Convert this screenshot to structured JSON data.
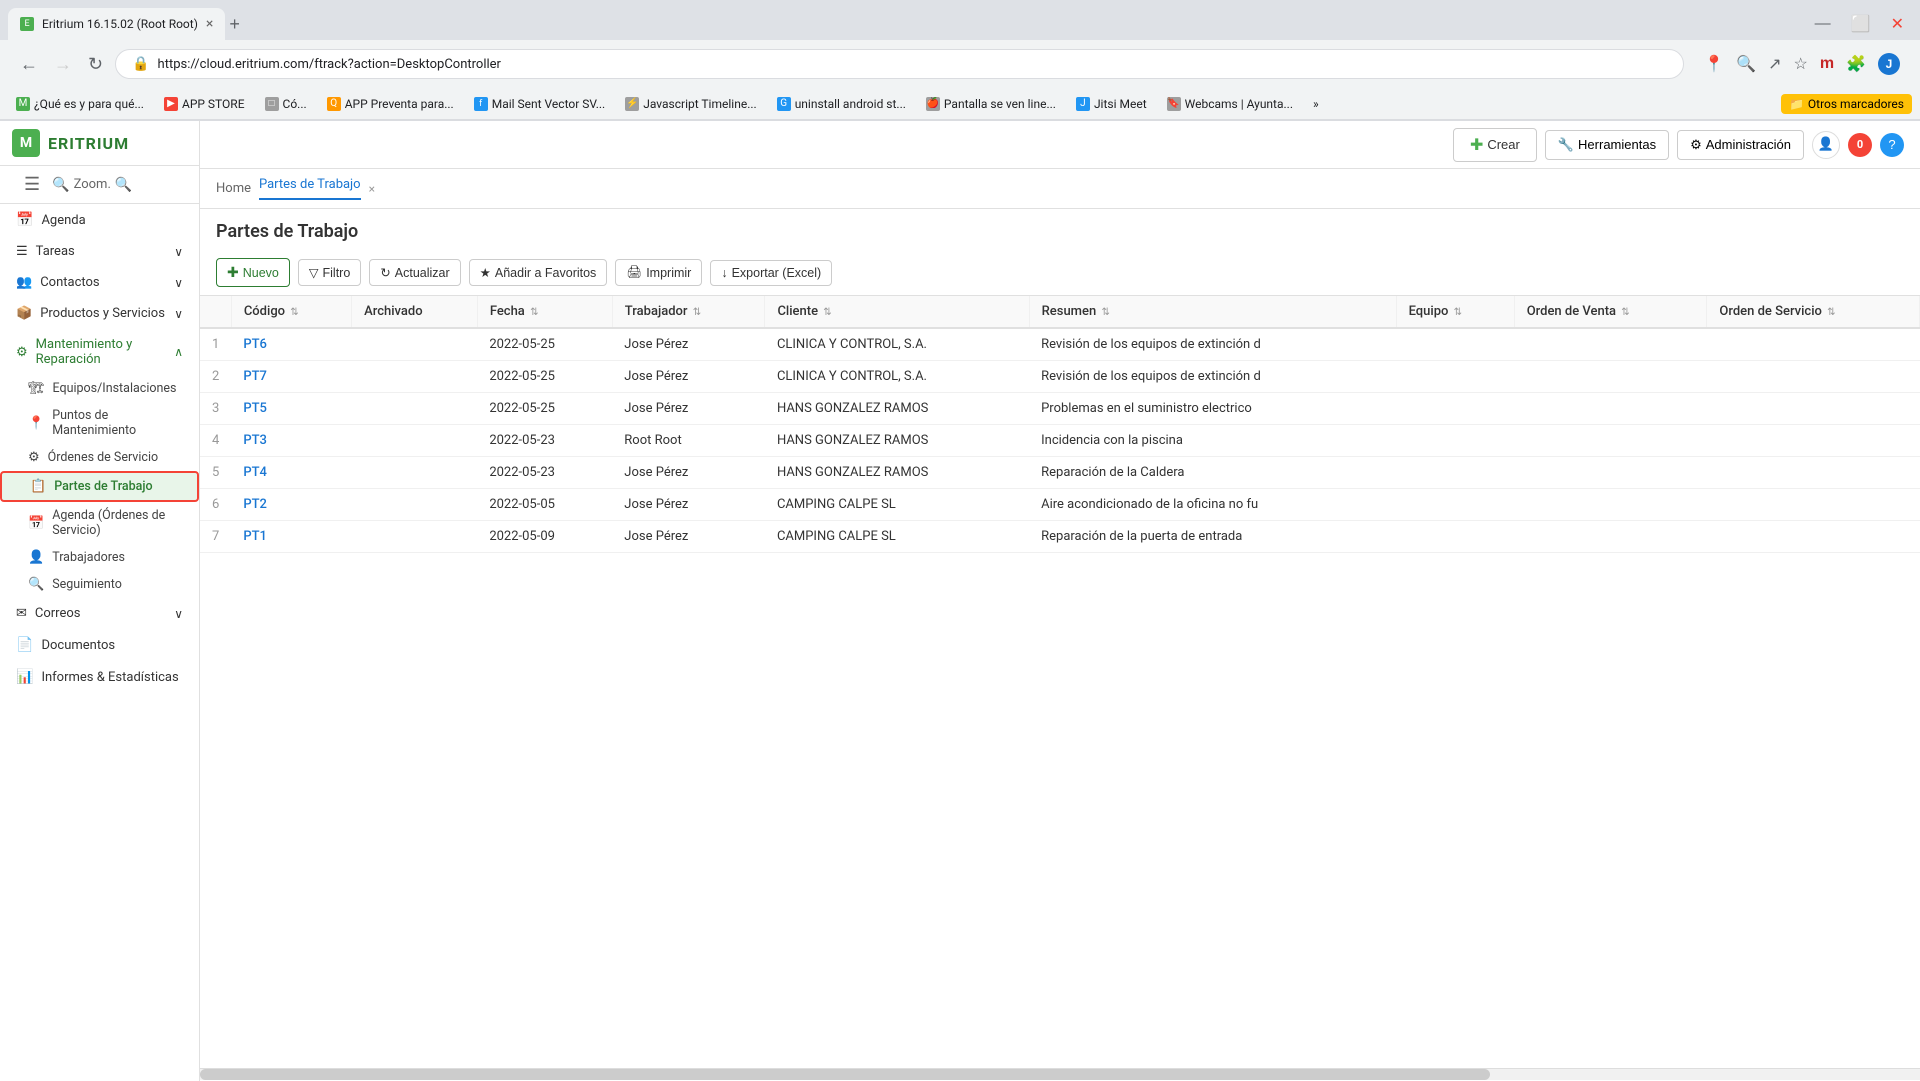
{
  "browser": {
    "tab_title": "Eritrium 16.15.02 (Root Root)",
    "url": "https://cloud.eritrium.com/ftrack?action=DesktopController",
    "bookmarks": [
      {
        "id": "bm1",
        "label": "¿Qué es y para qué...",
        "icon_color": "green",
        "icon_text": "M"
      },
      {
        "id": "bm2",
        "label": "APP STORE",
        "icon_color": "red",
        "icon_text": "▶"
      },
      {
        "id": "bm3",
        "label": "Có...",
        "icon_color": "gray",
        "icon_text": "□"
      },
      {
        "id": "bm4",
        "label": "APP Preventa para...",
        "icon_color": "orange",
        "icon_text": "Q"
      },
      {
        "id": "bm5",
        "label": "Mail Sent Vector SV...",
        "icon_color": "blue",
        "icon_text": "f"
      },
      {
        "id": "bm6",
        "label": "Javascript Timeline...",
        "icon_color": "gray",
        "icon_text": "⚡"
      },
      {
        "id": "bm7",
        "label": "uninstall android st...",
        "icon_color": "blue",
        "icon_text": "G"
      },
      {
        "id": "bm8",
        "label": "Pantalla se ven line...",
        "icon_color": "gray",
        "icon_text": "🍎"
      },
      {
        "id": "bm9",
        "label": "Jitsi Meet",
        "icon_color": "blue",
        "icon_text": "J"
      },
      {
        "id": "bm10",
        "label": "Webcams | Ayunta...",
        "icon_color": "gray",
        "icon_text": "🔖"
      },
      {
        "id": "bm11",
        "label": "»",
        "icon_color": "gray",
        "icon_text": ""
      },
      {
        "id": "bm12",
        "label": "Otros marcadores",
        "icon_color": "yellow",
        "icon_text": "📁"
      }
    ]
  },
  "app": {
    "logo_letter": "M",
    "logo_name": "ERITRIUM"
  },
  "topbar": {
    "zoom_label": "Zoom.",
    "crear_label": "Crear",
    "herramientas_label": "Herramientas",
    "admin_label": "Administración"
  },
  "sidebar": {
    "items": [
      {
        "id": "agenda",
        "label": "Agenda",
        "icon": "📅",
        "level": 0,
        "expandable": false
      },
      {
        "id": "tareas",
        "label": "Tareas",
        "icon": "☰",
        "level": 0,
        "expandable": true
      },
      {
        "id": "contactos",
        "label": "Contactos",
        "icon": "👥",
        "level": 0,
        "expandable": true
      },
      {
        "id": "productos",
        "label": "Productos y Servicios",
        "icon": "📦",
        "level": 0,
        "expandable": true
      },
      {
        "id": "mantenimiento",
        "label": "Mantenimiento y Reparación",
        "icon": "⚙",
        "level": 0,
        "expandable": true,
        "expanded": true
      },
      {
        "id": "equipos",
        "label": "Equipos/Instalaciones",
        "icon": "🏗",
        "level": 1
      },
      {
        "id": "puntos",
        "label": "Puntos de Mantenimiento",
        "icon": "📍",
        "level": 1
      },
      {
        "id": "ordenes",
        "label": "Órdenes de Servicio",
        "icon": "⚙",
        "level": 1
      },
      {
        "id": "partes",
        "label": "Partes de Trabajo",
        "icon": "📋",
        "level": 1,
        "active": true
      },
      {
        "id": "agenda_os",
        "label": "Agenda (Órdenes de Servicio)",
        "icon": "📅",
        "level": 1
      },
      {
        "id": "trabajadores",
        "label": "Trabajadores",
        "icon": "👤",
        "level": 1
      },
      {
        "id": "seguimiento",
        "label": "Seguimiento",
        "icon": "🔍",
        "level": 1
      },
      {
        "id": "correos",
        "label": "Correos",
        "icon": "✉",
        "level": 0,
        "expandable": true
      },
      {
        "id": "documentos",
        "label": "Documentos",
        "icon": "📄",
        "level": 0
      },
      {
        "id": "informes",
        "label": "Informes & Estadísticas",
        "icon": "📊",
        "level": 0
      }
    ]
  },
  "breadcrumbs": {
    "home": "Home",
    "current": "Partes de Trabajo",
    "close_symbol": "×"
  },
  "page": {
    "title": "Partes de Trabajo"
  },
  "actions": {
    "nuevo": "Nuevo",
    "filtro": "Filtro",
    "actualizar": "Actualizar",
    "favoritos": "Añadir a Favoritos",
    "imprimir": "Imprimir",
    "exportar": "Exportar (Excel)"
  },
  "table": {
    "columns": [
      {
        "id": "num",
        "label": "#"
      },
      {
        "id": "codigo",
        "label": "Código"
      },
      {
        "id": "archivado",
        "label": "Archivado"
      },
      {
        "id": "fecha",
        "label": "Fecha"
      },
      {
        "id": "trabajador",
        "label": "Trabajador"
      },
      {
        "id": "cliente",
        "label": "Cliente"
      },
      {
        "id": "resumen",
        "label": "Resumen"
      },
      {
        "id": "equipo",
        "label": "Equipo"
      },
      {
        "id": "orden_venta",
        "label": "Orden de Venta"
      },
      {
        "id": "orden_servicio",
        "label": "Orden de Servicio"
      }
    ],
    "rows": [
      {
        "num": "1",
        "codigo": "PT6",
        "archivado": "",
        "fecha": "2022-05-25",
        "trabajador": "Jose Pérez",
        "cliente": "CLINICA Y CONTROL, S.A.",
        "resumen": "Revisión de los equipos de extinción d",
        "equipo": "",
        "orden_venta": "",
        "orden_servicio": ""
      },
      {
        "num": "2",
        "codigo": "PT7",
        "archivado": "",
        "fecha": "2022-05-25",
        "trabajador": "Jose Pérez",
        "cliente": "CLINICA Y CONTROL, S.A.",
        "resumen": "Revisión de los equipos de extinción d",
        "equipo": "",
        "orden_venta": "",
        "orden_servicio": ""
      },
      {
        "num": "3",
        "codigo": "PT5",
        "archivado": "",
        "fecha": "2022-05-25",
        "trabajador": "Jose Pérez",
        "cliente": "HANS GONZALEZ RAMOS",
        "resumen": "Problemas en el suministro electrico",
        "equipo": "",
        "orden_venta": "",
        "orden_servicio": ""
      },
      {
        "num": "4",
        "codigo": "PT3",
        "archivado": "",
        "fecha": "2022-05-23",
        "trabajador": "Root Root",
        "cliente": "HANS GONZALEZ RAMOS",
        "resumen": "Incidencia con la piscina",
        "equipo": "",
        "orden_venta": "",
        "orden_servicio": ""
      },
      {
        "num": "5",
        "codigo": "PT4",
        "archivado": "",
        "fecha": "2022-05-23",
        "trabajador": "Jose Pérez",
        "cliente": "HANS GONZALEZ RAMOS",
        "resumen": "Reparación de la Caldera",
        "equipo": "",
        "orden_venta": "",
        "orden_servicio": ""
      },
      {
        "num": "6",
        "codigo": "PT2",
        "archivado": "",
        "fecha": "2022-05-05",
        "trabajador": "Jose Pérez",
        "cliente": "CAMPING CALPE SL",
        "resumen": "Aire acondicionado de la oficina no fu",
        "equipo": "",
        "orden_venta": "",
        "orden_servicio": ""
      },
      {
        "num": "7",
        "codigo": "PT1",
        "archivado": "",
        "fecha": "2022-05-09",
        "trabajador": "Jose Pérez",
        "cliente": "CAMPING CALPE SL",
        "resumen": "Reparación de la puerta de entrada",
        "equipo": "",
        "orden_venta": "",
        "orden_servicio": ""
      }
    ]
  }
}
